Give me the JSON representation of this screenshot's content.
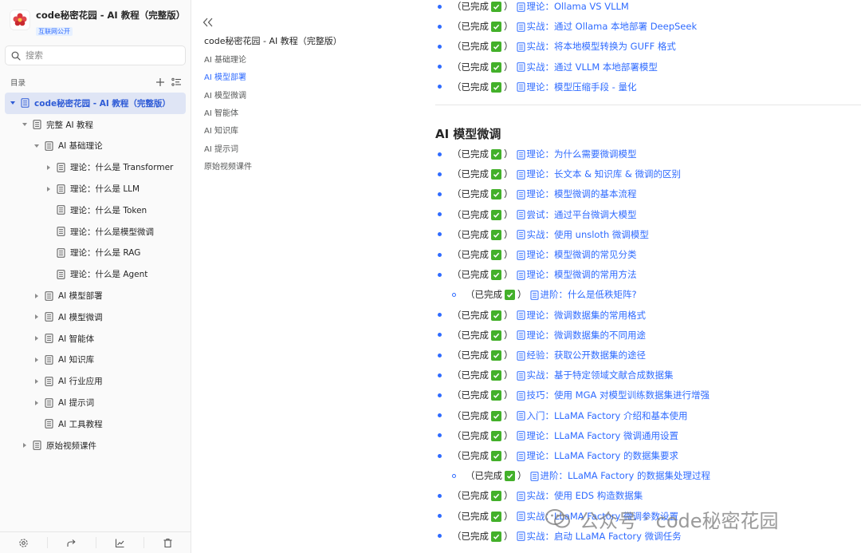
{
  "sidebar": {
    "book_title": "code秘密花园 - AI 教程（完整版）",
    "badge": "互联网公开",
    "search_placeholder": "搜索",
    "toc_label": "目录",
    "toc": [
      {
        "label": "code秘密花园 - AI 教程（完整版）",
        "level": 0,
        "toggle": "open",
        "active": true
      },
      {
        "label": "完整 AI 教程",
        "level": 1,
        "toggle": "open"
      },
      {
        "label": "AI 基础理论",
        "level": 2,
        "toggle": "open"
      },
      {
        "label": "理论：什么是 Transformer",
        "level": 3,
        "toggle": "closed"
      },
      {
        "label": "理论：什么是 LLM",
        "level": 3,
        "toggle": "closed"
      },
      {
        "label": "理论：什么是 Token",
        "level": 3,
        "toggle": "none"
      },
      {
        "label": "理论：什么是模型微调",
        "level": 3,
        "toggle": "none"
      },
      {
        "label": "理论：什么是 RAG",
        "level": 3,
        "toggle": "none"
      },
      {
        "label": "理论：什么是 Agent",
        "level": 3,
        "toggle": "none"
      },
      {
        "label": "AI 模型部署",
        "level": 2,
        "toggle": "closed"
      },
      {
        "label": "AI 模型微调",
        "level": 2,
        "toggle": "closed"
      },
      {
        "label": "AI 智能体",
        "level": 2,
        "toggle": "closed"
      },
      {
        "label": "AI 知识库",
        "level": 2,
        "toggle": "closed"
      },
      {
        "label": "AI 行业应用",
        "level": 2,
        "toggle": "closed"
      },
      {
        "label": "AI 提示词",
        "level": 2,
        "toggle": "closed"
      },
      {
        "label": "AI 工具教程",
        "level": 2,
        "toggle": "none"
      },
      {
        "label": "原始视频课件",
        "level": 1,
        "toggle": "closed"
      }
    ],
    "bottom_icons": [
      "gear-icon",
      "share-icon",
      "chart-icon",
      "trash-icon"
    ]
  },
  "outline": {
    "title": "code秘密花园 - AI 教程（完整版）",
    "items": [
      {
        "label": "AI 基础理论",
        "active": false
      },
      {
        "label": "AI 模型部署",
        "active": true
      },
      {
        "label": "AI 模型微调",
        "active": false
      },
      {
        "label": "AI 智能体",
        "active": false
      },
      {
        "label": "AI 知识库",
        "active": false
      },
      {
        "label": "AI 提示词",
        "active": false
      },
      {
        "label": "原始视频课件",
        "active": false
      }
    ]
  },
  "content": {
    "top_items": [
      {
        "status": "（已完成",
        "kind": "理论：",
        "title": "Ollama VS VLLM",
        "sub": false
      },
      {
        "status": "（已完成",
        "kind": "实战：",
        "title": "通过 Ollama 本地部署 DeepSeek",
        "sub": false
      },
      {
        "status": "（已完成",
        "kind": "实战：",
        "title": "将本地模型转换为 GUFF 格式",
        "sub": false
      },
      {
        "status": "（已完成",
        "kind": "实战：",
        "title": "通过 VLLM 本地部署模型",
        "sub": false
      },
      {
        "status": "（已完成",
        "kind": "理论：",
        "title": "模型压缩手段 - 量化",
        "sub": false
      }
    ],
    "section_title": "AI 模型微调",
    "items": [
      {
        "status": "（已完成",
        "kind": "理论：",
        "title": "为什么需要微调模型",
        "sub": false
      },
      {
        "status": "（已完成",
        "kind": "理论：",
        "title": "长文本 & 知识库 & 微调的区别",
        "sub": false
      },
      {
        "status": "（已完成",
        "kind": "理论：",
        "title": "模型微调的基本流程",
        "sub": false
      },
      {
        "status": "（已完成",
        "kind": "尝试：",
        "title": "通过平台微调大模型",
        "sub": false
      },
      {
        "status": "（已完成",
        "kind": "实战：",
        "title": "使用 unsloth 微调模型",
        "sub": false
      },
      {
        "status": "（已完成",
        "kind": "理论：",
        "title": "模型微调的常见分类",
        "sub": false
      },
      {
        "status": "（已完成",
        "kind": "理论：",
        "title": "模型微调的常用方法",
        "sub": false
      },
      {
        "status": "（已完成",
        "kind": "进阶：",
        "title": "什么是低秩矩阵?",
        "sub": true
      },
      {
        "status": "（已完成",
        "kind": "理论：",
        "title": "微调数据集的常用格式",
        "sub": false
      },
      {
        "status": "（已完成",
        "kind": "理论：",
        "title": "微调数据集的不同用途",
        "sub": false
      },
      {
        "status": "（已完成",
        "kind": "经验：",
        "title": "获取公开数据集的途径",
        "sub": false
      },
      {
        "status": "（已完成",
        "kind": "实战：",
        "title": "基于特定领域文献合成数据集",
        "sub": false
      },
      {
        "status": "（已完成",
        "kind": "技巧：",
        "title": "使用 MGA 对模型训练数据集进行增强",
        "sub": false
      },
      {
        "status": "（已完成",
        "kind": "入门：",
        "title": "LLaMA Factory 介绍和基本使用",
        "sub": false
      },
      {
        "status": "（已完成",
        "kind": "理论：",
        "title": "LLaMA Factory 微调通用设置",
        "sub": false
      },
      {
        "status": "（已完成",
        "kind": "理论：",
        "title": "LLaMA Factory 的数据集要求",
        "sub": false
      },
      {
        "status": "（已完成",
        "kind": "进阶：",
        "title": "LLaMA Factory 的数据集处理过程",
        "sub": true
      },
      {
        "status": "（已完成",
        "kind": "实战：",
        "title": "使用 EDS 构造数据集",
        "sub": false
      },
      {
        "status": "（已完成",
        "kind": "实战：",
        "title": "LLaMA Factory 微调参数设置",
        "sub": false
      },
      {
        "status": "（已完成",
        "kind": "实战：",
        "title": "启动 LLaMA Factory 微调任务",
        "sub": false
      }
    ]
  },
  "watermark": {
    "channel": "公众号",
    "name": "code秘密花园"
  },
  "colors": {
    "accent": "#2f6bff",
    "check": "#43b02a",
    "active_bg": "#dfe5f5"
  }
}
